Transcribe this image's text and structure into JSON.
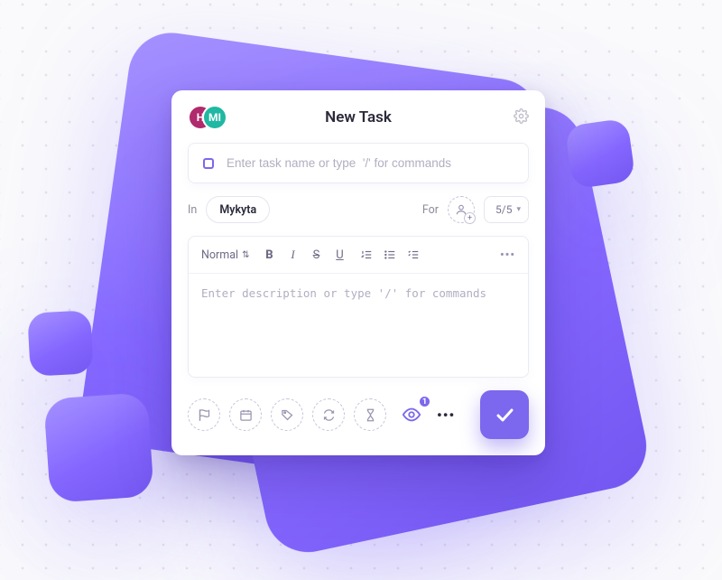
{
  "header": {
    "title": "New Task",
    "avatars": [
      {
        "initial": "H",
        "bg": "#b02a6d"
      },
      {
        "initial": "MI",
        "bg": "#1fb8a3"
      }
    ],
    "gear_icon": "settings"
  },
  "task_name": {
    "value": "",
    "placeholder": "Enter task name or type  '/' for commands",
    "status_color": "#7b68ee"
  },
  "meta": {
    "in_label": "In",
    "list_selected": "Mykyta",
    "for_label": "For",
    "assignee_icon": "add-user",
    "priority": {
      "label": "5/5"
    }
  },
  "editor": {
    "style_label": "Normal",
    "buttons": {
      "bold": "B",
      "italic": "I",
      "strike": "S",
      "underline": "U"
    },
    "description_value": "",
    "description_placeholder": "Enter description or type '/' for commands"
  },
  "footer": {
    "action_icons": [
      "flag",
      "date",
      "tag",
      "recurring",
      "time-estimate"
    ],
    "watchers": {
      "count": "1"
    },
    "submit_icon": "check"
  },
  "colors": {
    "accent": "#7b68ee",
    "text": "#2a2a3a",
    "muted": "#9a95b0"
  }
}
